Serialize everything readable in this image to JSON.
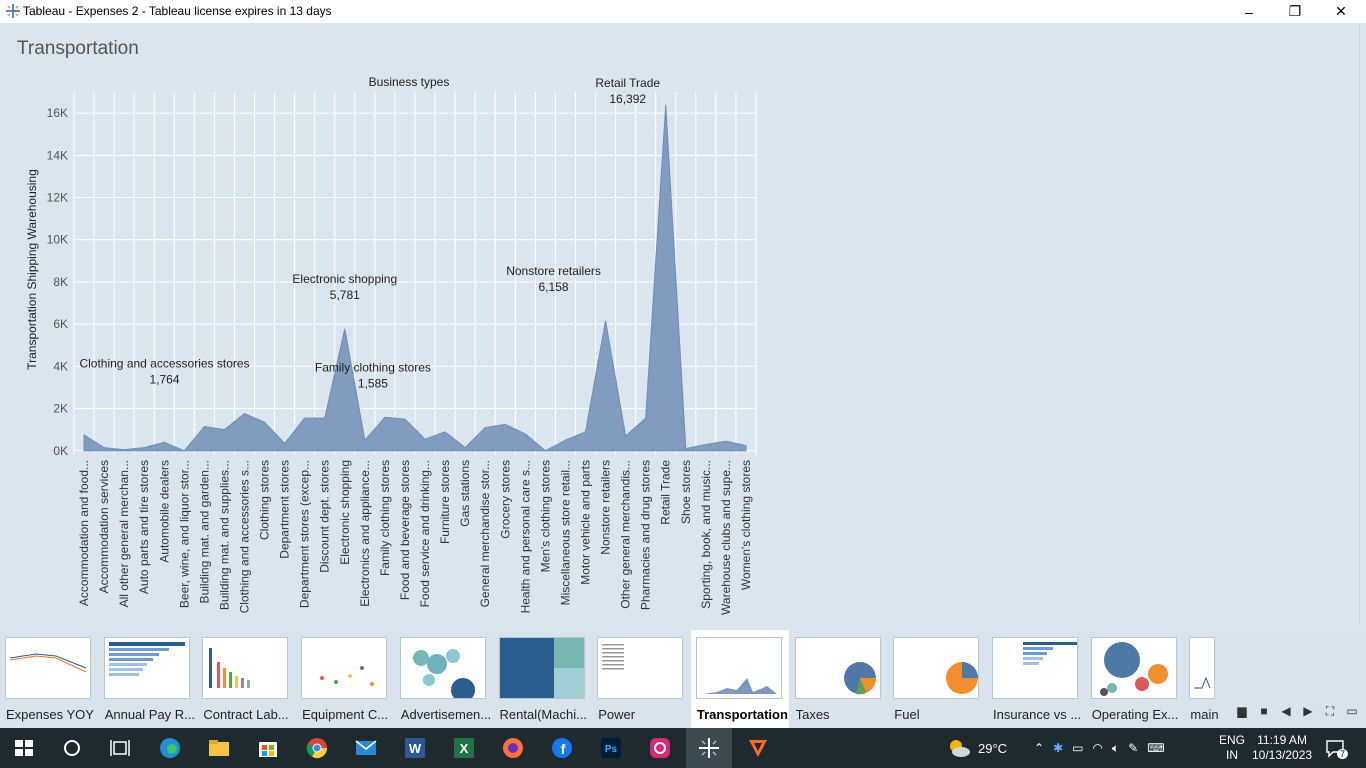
{
  "window": {
    "title": "Tableau - Expenses 2 - Tableau license expires in 13 days",
    "minimize": "–",
    "restore": "❐",
    "close": "✕"
  },
  "sheet": {
    "title": "Transportation"
  },
  "chart_data": {
    "type": "area",
    "title": "",
    "xlabel": "Business types",
    "ylabel": "Transportation Shipping Warehousing",
    "ylim": [
      -200,
      17000
    ],
    "yticks": [
      0,
      2000,
      4000,
      6000,
      8000,
      10000,
      12000,
      14000,
      16000
    ],
    "ytick_labels": [
      "0K",
      "2K",
      "4K",
      "6K",
      "8K",
      "10K",
      "12K",
      "14K",
      "16K"
    ],
    "grid": true,
    "color": "#7b98bd",
    "categories": [
      "Accommodation and food...",
      "Accommodation services",
      "All other general merchan...",
      "Auto parts and tire stores",
      "Automobile dealers",
      "Beer, wine, and liquor stor...",
      "Building mat. and garden...",
      "Building mat. and supplies...",
      "Clothing and accessories s...",
      "Clothing stores",
      "Department stores",
      "Department stores (excep...",
      "Discount dept. stores",
      "Electronic shopping",
      "Electronics and appliance...",
      "Family clothing stores",
      "Food and beverage stores",
      "Food service and drinking...",
      "Furniture stores",
      "Gas stations",
      "General merchandise stor...",
      "Grocery stores",
      "Health and personal care s...",
      "Men's clothing stores",
      "Miscellaneous store retail...",
      "Motor vehicle and parts",
      "Nonstore retailers",
      "Other general merchandis...",
      "Pharmacies and drug stores",
      "Retail Trade",
      "Shoe stores",
      "Sporting, book, and music...",
      "Warehouse clubs and supe...",
      "Women's clothing stores"
    ],
    "values": [
      750,
      150,
      50,
      150,
      400,
      0,
      1150,
      1000,
      1764,
      1350,
      350,
      1550,
      1550,
      5781,
      500,
      1585,
      1500,
      550,
      900,
      150,
      1100,
      1250,
      800,
      0,
      500,
      900,
      6158,
      700,
      1550,
      16392,
      100,
      300,
      450,
      250
    ],
    "annotations": [
      {
        "label": "Clothing and accessories stores",
        "value_text": "1,764",
        "index": 8
      },
      {
        "label": "Electronic shopping",
        "value_text": "5,781",
        "index": 13
      },
      {
        "label": "Family clothing stores",
        "value_text": "1,585",
        "index": 15
      },
      {
        "label": "Nonstore retailers",
        "value_text": "6,158",
        "index": 26
      },
      {
        "label": "Retail Trade",
        "value_text": "16,392",
        "index": 29
      }
    ]
  },
  "tabs": [
    {
      "label": "Expenses YOY"
    },
    {
      "label": "Annual Pay R..."
    },
    {
      "label": "Contract Lab..."
    },
    {
      "label": "Equipment C..."
    },
    {
      "label": "Advertisemen..."
    },
    {
      "label": "Rental(Machi..."
    },
    {
      "label": "Power"
    },
    {
      "label": "Transportation",
      "active": true
    },
    {
      "label": "Taxes"
    },
    {
      "label": "Fuel"
    },
    {
      "label": "Insurance vs ..."
    },
    {
      "label": "Operating Ex..."
    },
    {
      "label": "main"
    }
  ],
  "tab_nav": {
    "filmstrip": "▆",
    "show_sheets": "■",
    "prev": "◀",
    "next": "▶",
    "fit": "⛶",
    "present": "▭"
  },
  "taskbar": {
    "apps": [
      "start",
      "search",
      "task-view",
      "edge",
      "file-explorer",
      "store",
      "chrome",
      "mail",
      "word",
      "excel",
      "firefox",
      "facebook",
      "photoshop",
      "instagram",
      "tableau",
      "vectornator"
    ],
    "weather": "29°C",
    "lang_top": "ENG",
    "lang_bottom": "IN",
    "time": "11:19 AM",
    "date": "10/13/2023",
    "notifications": "7"
  }
}
